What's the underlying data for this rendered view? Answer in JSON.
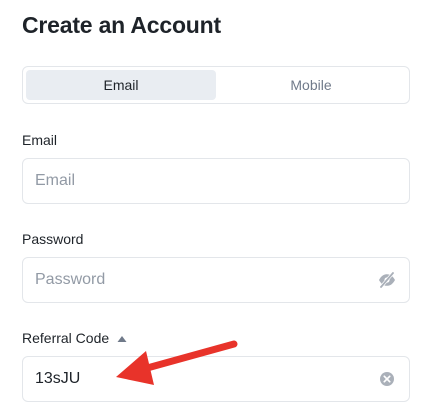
{
  "page": {
    "title": "Create an Account"
  },
  "tabs": [
    {
      "label": "Email",
      "active": true
    },
    {
      "label": "Mobile",
      "active": false
    }
  ],
  "email": {
    "label": "Email",
    "value": "",
    "placeholder": "Email"
  },
  "password": {
    "label": "Password",
    "value": "",
    "placeholder": "Password",
    "toggle_icon": "eye-slash-icon"
  },
  "referral": {
    "label": "Referral Code",
    "expand_icon": "caret-up-icon",
    "value": "13sJU",
    "placeholder": "",
    "clear_icon": "clear-circle-icon"
  },
  "annotation": {
    "icon": "red-arrow",
    "color": "#e8332a"
  },
  "colors": {
    "text_primary": "#1e2329",
    "text_muted": "#707a8a",
    "border": "#e3e6ea",
    "tab_active_bg": "#e9edf2",
    "annotation": "#e8332a"
  }
}
